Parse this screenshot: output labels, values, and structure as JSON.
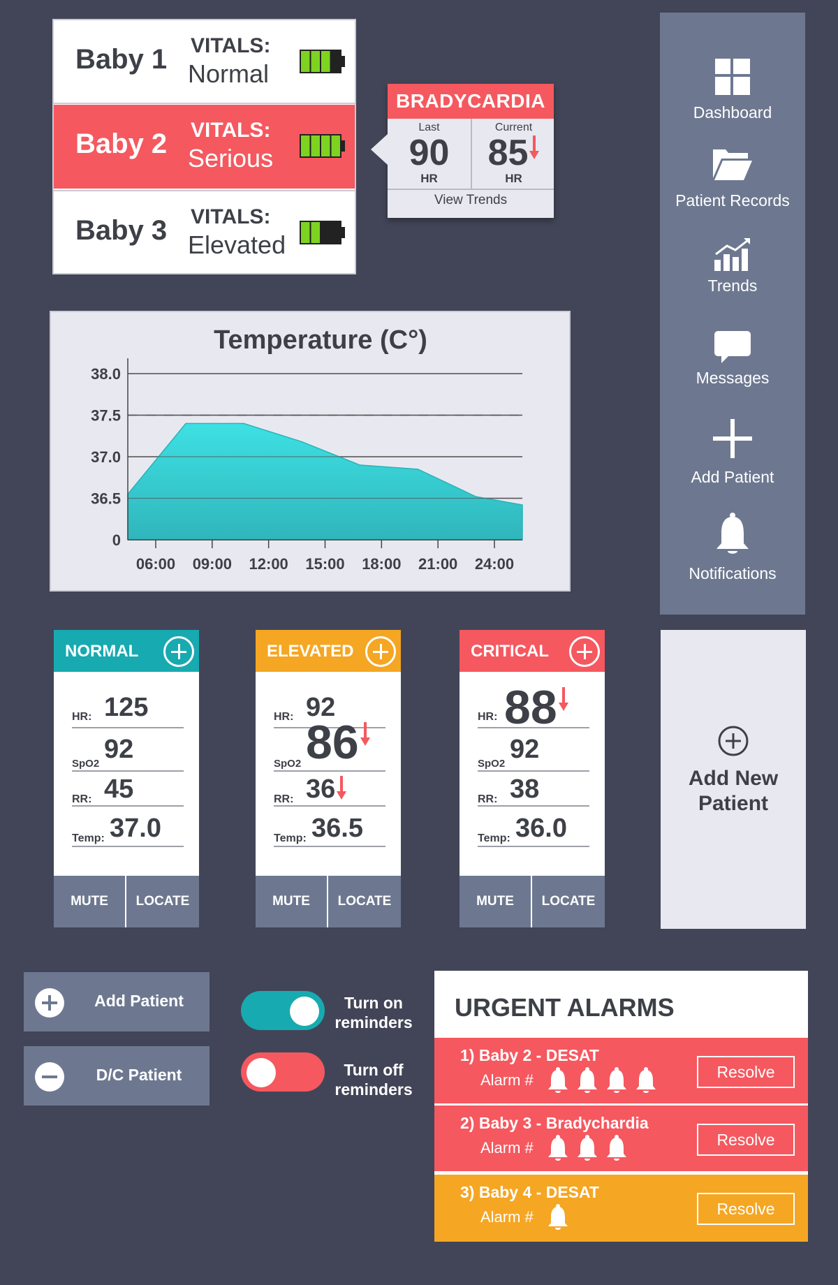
{
  "patients": [
    {
      "name": "Baby 1",
      "vitals_label": "VITALS:",
      "vitals_status": "Normal",
      "battery_level": 0.75
    },
    {
      "name": "Baby 2",
      "vitals_label": "VITALS:",
      "vitals_status": "Serious",
      "battery_level": 1.0
    },
    {
      "name": "Baby 3",
      "vitals_label": "VITALS:",
      "vitals_status": "Elevated",
      "battery_level": 0.5
    }
  ],
  "brady_popup": {
    "title": "BRADYCARDIA",
    "last_label": "Last",
    "last_value": "90",
    "last_unit": "HR",
    "current_label": "Current",
    "current_value": "85",
    "current_unit": "HR",
    "view_trends": "View Trends"
  },
  "sidebar": {
    "items": [
      {
        "label": "Dashboard",
        "icon": "dashboard-icon"
      },
      {
        "label": "Patient Records",
        "icon": "folder-icon"
      },
      {
        "label": "Trends",
        "icon": "trends-icon"
      },
      {
        "label": "Messages",
        "icon": "message-icon"
      },
      {
        "label": "Add Patient",
        "icon": "plus-icon"
      },
      {
        "label": "Notifications",
        "icon": "bell-icon"
      }
    ]
  },
  "chart_data": {
    "type": "area",
    "title": "Temperature (C°)",
    "x_ticks": [
      "06:00",
      "09:00",
      "12:00",
      "15:00",
      "18:00",
      "21:00",
      "24:00"
    ],
    "y_ticks": [
      "0",
      "36.5",
      "37.0",
      "37.5",
      "38.0"
    ],
    "y_tick_values": [
      36.0,
      36.5,
      37.0,
      37.5,
      38.0
    ],
    "ylim": [
      36.0,
      38.0
    ],
    "xlim": [
      4.3,
      24.7
    ],
    "reference_line": 37.5,
    "x": [
      4.3,
      7.3,
      10.3,
      13.3,
      16.3,
      19.3,
      22.3,
      24.7
    ],
    "values": [
      36.55,
      37.4,
      37.4,
      37.18,
      36.9,
      36.85,
      36.52,
      36.42
    ],
    "fill_color": "#36c9cf"
  },
  "cards": [
    {
      "status": "NORMAL",
      "color": "#17aab0",
      "hr_label": "HR:",
      "hr": "125",
      "hr_down": false,
      "spo2_label": "SpO2",
      "spo2": "92",
      "spo2_down": false,
      "rr_label": "RR:",
      "rr": "45",
      "rr_down": false,
      "temp_label": "Temp:",
      "temp": "37.0",
      "mute": "MUTE",
      "locate": "LOCATE"
    },
    {
      "status": "ELEVATED",
      "color": "#f5a623",
      "hr_label": "HR:",
      "hr": "92",
      "hr_down": false,
      "spo2_label": "SpO2",
      "spo2": "86",
      "spo2_down": true,
      "rr_label": "RR:",
      "rr": "36",
      "rr_down": true,
      "temp_label": "Temp:",
      "temp": "36.5",
      "mute": "MUTE",
      "locate": "LOCATE"
    },
    {
      "status": "CRITICAL",
      "color": "#f5585f",
      "hr_label": "HR:",
      "hr": "88",
      "hr_down": true,
      "spo2_label": "SpO2",
      "spo2": "92",
      "spo2_down": false,
      "rr_label": "RR:",
      "rr": "38",
      "rr_down": false,
      "temp_label": "Temp:",
      "temp": "36.0",
      "mute": "MUTE",
      "locate": "LOCATE"
    }
  ],
  "add_new": {
    "label_line1": "Add New",
    "label_line2": "Patient"
  },
  "actions": {
    "add_patient": "Add Patient",
    "dc_patient": "D/C Patient"
  },
  "toggles": [
    {
      "line1": "Turn on",
      "line2": "reminders",
      "on": true,
      "color": "#17aab0"
    },
    {
      "line1": "Turn off",
      "line2": "reminders",
      "on": false,
      "color": "#f5585f"
    }
  ],
  "alarms": {
    "title": "URGENT ALARMS",
    "alarm_label": "Alarm #",
    "resolve_label": "Resolve",
    "items": [
      {
        "text": "1) Baby 2 - DESAT",
        "bells": 4,
        "color": "#f5585f"
      },
      {
        "text": "2) Baby 3 - Bradychardia",
        "bells": 3,
        "color": "#f5585f"
      },
      {
        "text": "3) Baby 4 - DESAT",
        "bells": 1,
        "color": "#f5a623"
      }
    ]
  }
}
